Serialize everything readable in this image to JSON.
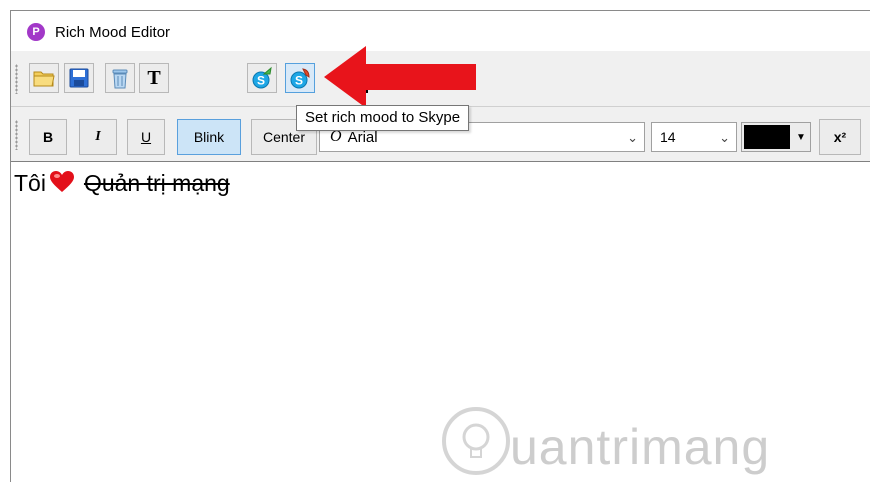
{
  "window": {
    "title": "Rich Mood Editor",
    "app_icon_letter": "P"
  },
  "toolbar1": {
    "buttons": [
      {
        "name": "open-folder",
        "icon": "folder-icon"
      },
      {
        "name": "save",
        "icon": "floppy-disk-icon"
      },
      {
        "name": "clear",
        "icon": "trash-icon"
      },
      {
        "name": "text",
        "icon": "text-T-icon",
        "glyph": "T"
      },
      {
        "name": "get-mood-from-skype",
        "icon": "skype-get-icon"
      },
      {
        "name": "set-mood-to-skype",
        "icon": "skype-set-icon",
        "active": true
      }
    ]
  },
  "tooltip": {
    "text": "Set rich mood to Skype"
  },
  "toolbar2": {
    "bold_label": "B",
    "italic_label": "I",
    "underline_label": "U",
    "blink_label": "Blink",
    "center_label": "Center",
    "font_name": "Arial",
    "font_size": "14",
    "color": "#000000",
    "superscript_label": "x²"
  },
  "editor": {
    "text_before": "Tôi",
    "text_strike": "Quản trị mạng"
  },
  "watermark": {
    "text": "uantrimang"
  },
  "colors": {
    "accent": "#a238c8",
    "arrow": "#e8141b",
    "active_btn": "#cce4f7"
  }
}
